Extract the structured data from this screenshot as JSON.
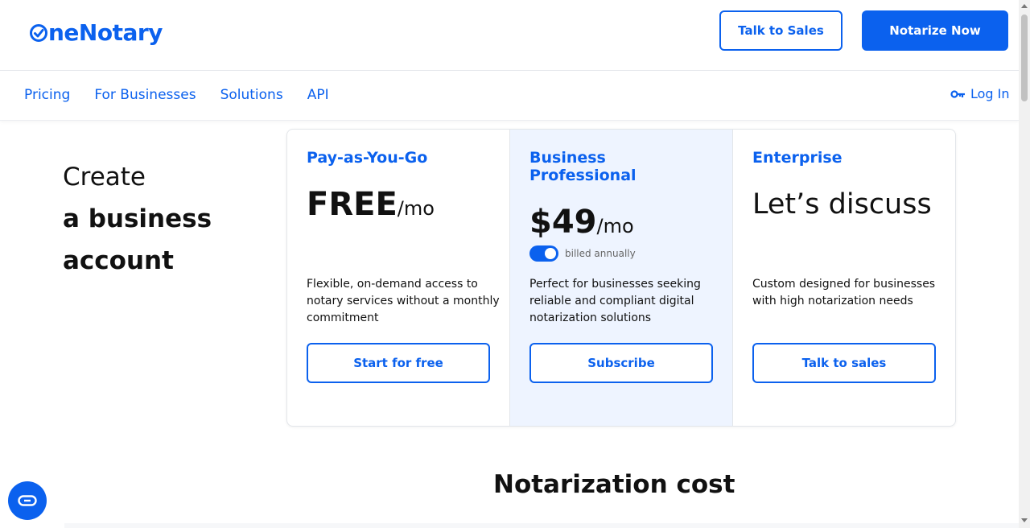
{
  "brand": {
    "name": "neNotary",
    "accent": "#0b61ee"
  },
  "header": {
    "talk_to_sales": "Talk to Sales",
    "notarize_now": "Notarize Now"
  },
  "nav": {
    "items": [
      "Pricing",
      "For Businesses",
      "Solutions",
      "API"
    ],
    "login": "Log In",
    "login_icon": "key-icon"
  },
  "hero": {
    "line1": "Create",
    "line2": "a business",
    "line3": "account"
  },
  "plans": [
    {
      "title": "Pay-as-You-Go",
      "price": "FREE",
      "per": "/mo",
      "description": "Flexible, on-demand access to notary services without a monthly commitment",
      "button": "Start for free"
    },
    {
      "title": "Business Professional",
      "price": "$49",
      "per": "/mo",
      "toggle_label": "billed annually",
      "toggle_on": true,
      "description": "Perfect for businesses seeking reliable and compliant digital notarization solutions",
      "button": "Subscribe"
    },
    {
      "title": "Enterprise",
      "price": "Let’s discuss",
      "description": "Custom designed for businesses with high notarization needs",
      "button": "Talk to sales"
    }
  ],
  "section": {
    "title": "Notarization cost"
  },
  "chat": {
    "icon": "chat-icon"
  }
}
